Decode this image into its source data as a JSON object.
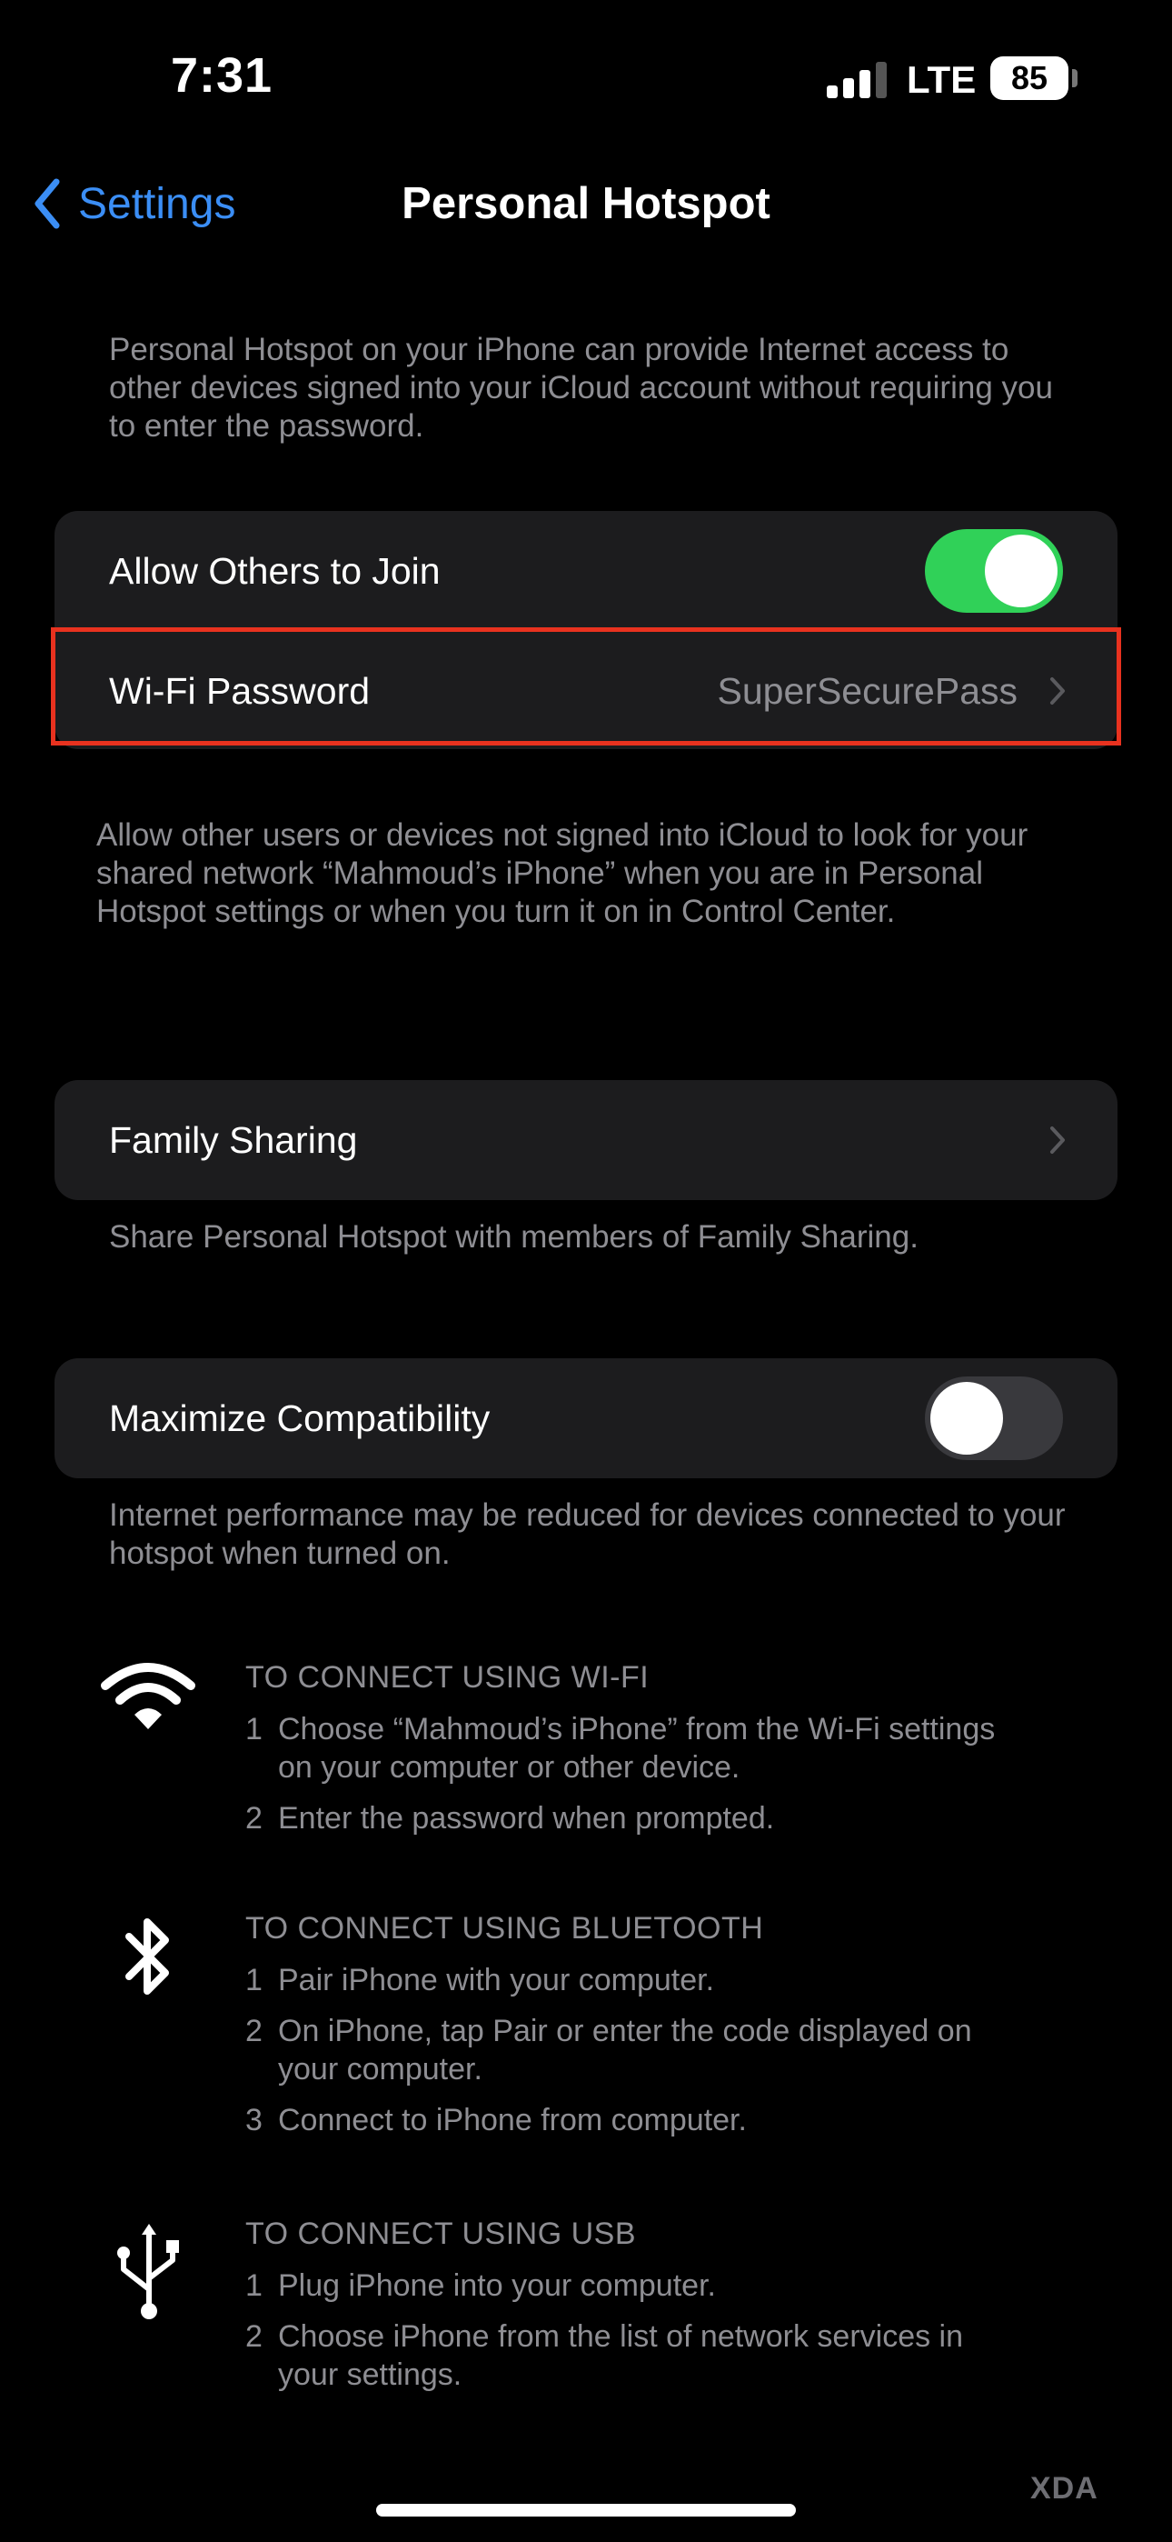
{
  "status_bar": {
    "time": "7:31",
    "network": "LTE",
    "battery": "85"
  },
  "nav": {
    "back_label": "Settings",
    "title": "Personal Hotspot"
  },
  "intro_note": "Personal Hotspot on your iPhone can provide Internet access to other devices signed into your iCloud account without requiring you to enter the password.",
  "group1": {
    "allow_label": "Allow Others to Join",
    "allow_toggle": "on",
    "wifi_label": "Wi-Fi Password",
    "wifi_value": "SuperSecurePass"
  },
  "group1_note": "Allow other users or devices not signed into iCloud to look for your shared network “Mahmoud’s iPhone” when you are in Personal Hotspot settings or when you turn it on in Control Center.",
  "family": {
    "label": "Family Sharing",
    "note": "Share Personal Hotspot with members of Family Sharing."
  },
  "maximize": {
    "label": "Maximize Compatibility",
    "toggle": "off",
    "note": "Internet performance may be reduced for devices connected to your hotspot when turned on."
  },
  "instructions": {
    "wifi": {
      "title": "TO CONNECT USING WI-FI",
      "steps": [
        {
          "num": "1",
          "line1": "Choose “Mahmoud’s iPhone” from the Wi-Fi settings",
          "line2": "on your computer or other device."
        },
        {
          "num": "2",
          "line1": "Enter the password when prompted."
        }
      ]
    },
    "bluetooth": {
      "title": "TO CONNECT USING BLUETOOTH",
      "steps": [
        {
          "num": "1",
          "line1": "Pair iPhone with your computer."
        },
        {
          "num": "2",
          "line1": "On iPhone, tap Pair or enter the code displayed on",
          "line2": "your computer."
        },
        {
          "num": "3",
          "line1": "Connect to iPhone from computer."
        }
      ]
    },
    "usb": {
      "title": "TO CONNECT USING USB",
      "steps": [
        {
          "num": "1",
          "line1": "Plug iPhone into your computer."
        },
        {
          "num": "2",
          "line1": "Choose iPhone from the list of network services in",
          "line2": "your settings."
        }
      ]
    }
  },
  "watermark": "XDA",
  "colors": {
    "accent": "#3b8ef5",
    "toggle_on": "#30d158",
    "highlight": "#e8321f"
  }
}
